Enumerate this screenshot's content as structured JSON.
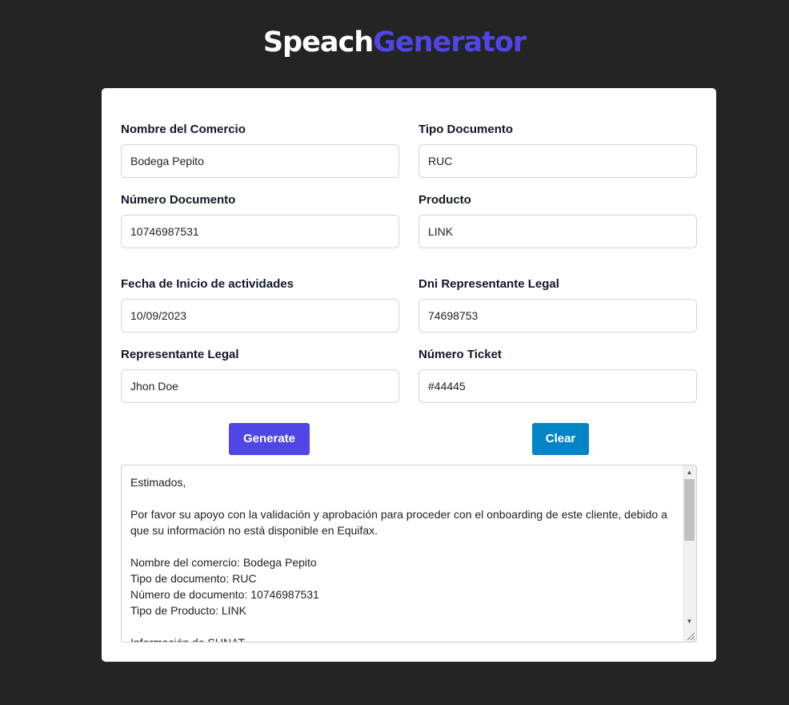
{
  "header": {
    "title_part1": "Speach",
    "title_part2": "Generator"
  },
  "colors": {
    "background": "#242424",
    "accent": "#4f46e5",
    "clear_button": "#0284c7",
    "card": "#ffffff"
  },
  "form": {
    "nombre_comercio": {
      "label": "Nombre del Comercio",
      "value": "Bodega Pepito"
    },
    "tipo_documento": {
      "label": "Tipo Documento",
      "value": "RUC"
    },
    "numero_documento": {
      "label": "Número Documento",
      "value": "10746987531"
    },
    "producto": {
      "label": "Producto",
      "value": "LINK"
    },
    "fecha_inicio": {
      "label": "Fecha de Inicio de actividades",
      "value": "10/09/2023"
    },
    "dni_representante": {
      "label": "Dni Representante Legal",
      "value": "74698753"
    },
    "representante": {
      "label": "Representante Legal",
      "value": "Jhon Doe"
    },
    "numero_ticket": {
      "label": "Número Ticket",
      "value": "#44445"
    }
  },
  "buttons": {
    "generate": "Generate",
    "clear": "Clear"
  },
  "output": {
    "text": "Estimados,\n\nPor favor su apoyo con la validación y aprobación para proceder con el onboarding de este cliente, debido a que su información no está disponible en Equifax.\n\nNombre del comercio: Bodega Pepito\nTipo de documento: RUC\nNúmero de documento: 10746987531\nTipo de Producto: LINK\n\nInformación de SUNAT"
  }
}
